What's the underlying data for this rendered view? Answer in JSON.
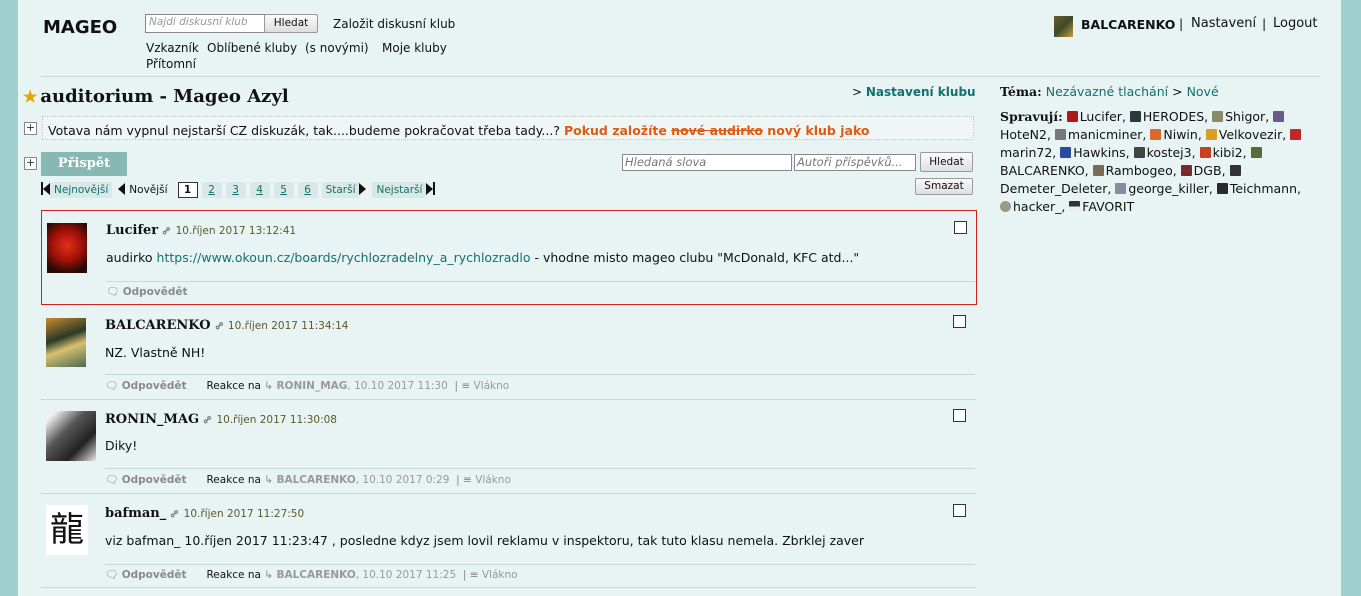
{
  "header": {
    "logo": "MAGEO",
    "search_placeholder": "Najdi diskusní klub",
    "search_button": "Hledat",
    "create_club": "Založit diskusní klub",
    "nav": [
      "Vzkazník",
      "Oblíbené kluby",
      "(s novými)",
      "Moje kluby",
      "Přítomní"
    ],
    "user": "BALCARENKO",
    "settings": "Nastavení",
    "logout": "Logout",
    "separator": "|"
  },
  "club": {
    "title": "auditorium - Mageo Azyl",
    "settings_prefix": ">",
    "settings_link": "Nastavení klubu",
    "description_plain": "Votava nám vypnul nejstarší CZ diskuzák, tak....budeme pokračovat třeba tady...? ",
    "description_orange1": "Pokud založíte ",
    "description_strike": "nové audirko",
    "description_orange2": " nový klub jako"
  },
  "toolbar": {
    "post_button": "Přispět",
    "keywords_placeholder": "Hledaná slova",
    "authors_placeholder": "Autoři příspěvků...",
    "search_button": "Hledat",
    "delete_button": "Smazat"
  },
  "pager": {
    "newest": "Nejnovější",
    "newer": "Novější",
    "pages": [
      "1",
      "2",
      "3",
      "4",
      "5",
      "6"
    ],
    "current_page": "1",
    "older": "Starší",
    "oldest": "Nejstarší"
  },
  "posts": [
    {
      "author": "Lucifer",
      "time": "10.říjen 2017 13:12:41",
      "text_before": "audirko ",
      "link": "https://www.okoun.cz/boards/rychlozradelny_a_rychlozradlo",
      "text_after": " - vhodne misto mageo clubu \"McDonald, KFC atd...\"",
      "reply": "Odpovědět"
    },
    {
      "author": "BALCARENKO",
      "time": "10.říjen 2017 11:34:14",
      "text": "NZ. Vlastně NH!",
      "reply": "Odpovědět",
      "reaction_label": "Reakce na",
      "reaction_user": "RONIN_MAG",
      "reaction_date": ", 10.10 2017 11:30",
      "thread": "Vlákno"
    },
    {
      "author": "RONIN_MAG",
      "time": "10.říjen 2017 11:30:08",
      "text": "Diky!",
      "reply": "Odpovědět",
      "reaction_label": "Reakce na",
      "reaction_user": "BALCARENKO",
      "reaction_date": ", 10.10 2017 0:29",
      "thread": "Vlákno"
    },
    {
      "author": "bafman_",
      "time": "10.říjen 2017 11:27:50",
      "text": "viz bafman_ 10.říjen 2017 11:23:47 , posledne kdyz jsem lovil reklamu v inspektoru, tak tuto klasu nemela. Zbrklej zaver",
      "reply": "Odpovědět",
      "reaction_label": "Reakce na",
      "reaction_user": "BALCARENKO",
      "reaction_date": ", 10.10 2017 11:25",
      "thread": "Vlákno"
    }
  ],
  "sidebar": {
    "topic_label": "Téma:",
    "topic_link": "Nezávazné tlachání",
    "topic_sep": ">",
    "topic_new": "Nové",
    "admins_label": "Spravují:",
    "admins": [
      "Lucifer",
      "HERODES",
      "Shigor",
      "HoteN2",
      "manicminer",
      "Niwin",
      "Velkovezir",
      "marin72",
      "Hawkins",
      "kostej3",
      "kibi2",
      "BALCARENKO",
      "Rambogeo",
      "DGB",
      "Demeter_Deleter",
      "george_killer",
      "Teichmann",
      "hacker_",
      "FAVORIT"
    ]
  },
  "colors": {
    "page_bg": "#e8f3f3",
    "frame": "#9fcfcf",
    "link": "#12706e",
    "accent_orange": "#e05a10",
    "highlight_border": "#d02020",
    "post_button": "#88b8b4"
  }
}
